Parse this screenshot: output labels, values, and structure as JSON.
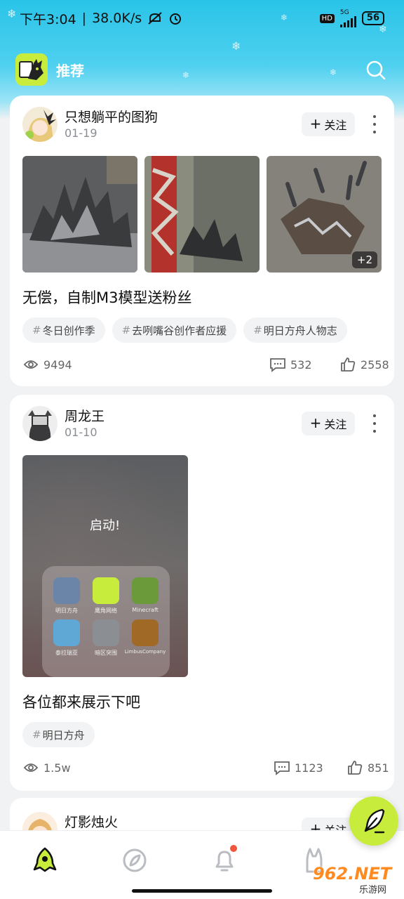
{
  "status_bar": {
    "time": "下午3:04",
    "separator": "|",
    "speed": "38.0K/s",
    "hd_badge": "HD",
    "network": "5G",
    "battery": "56"
  },
  "topbar": {
    "title": "推荐"
  },
  "posts": [
    {
      "author": "只想躺平的图狗",
      "date": "01-19",
      "follow_label": "关注",
      "follow_plus": "+",
      "title": "无偿，自制M3模型送粉丝",
      "more_photos": "+2",
      "tags": [
        {
          "hash": "#",
          "label": "冬日创作季"
        },
        {
          "hash": "#",
          "label": "去咧嘴谷创作者应援"
        },
        {
          "hash": "#",
          "label": "明日方舟人物志"
        }
      ],
      "views": "9494",
      "comments": "532",
      "likes": "2558"
    },
    {
      "author": "周龙王",
      "date": "01-10",
      "follow_label": "关注",
      "follow_plus": "+",
      "image_caption": "启动!",
      "apps": [
        "明日方舟",
        "鹰角网络",
        "Minecraft",
        "泰拉瑞亚",
        "暗区突围",
        "LimbusCompany"
      ],
      "title": "各位都来展示下吧",
      "tags": [
        {
          "hash": "#",
          "label": "明日方舟"
        }
      ],
      "views": "1.5w",
      "comments": "1123",
      "likes": "851"
    },
    {
      "author": "灯影烛火",
      "follow_label": "关注",
      "follow_plus": "+"
    }
  ],
  "watermark": {
    "brand": "962.NET",
    "sub": "乐游网"
  },
  "colors": {
    "accent": "#c8ec3c",
    "header": "#29c4e8",
    "notification_dot": "#f2553d"
  }
}
